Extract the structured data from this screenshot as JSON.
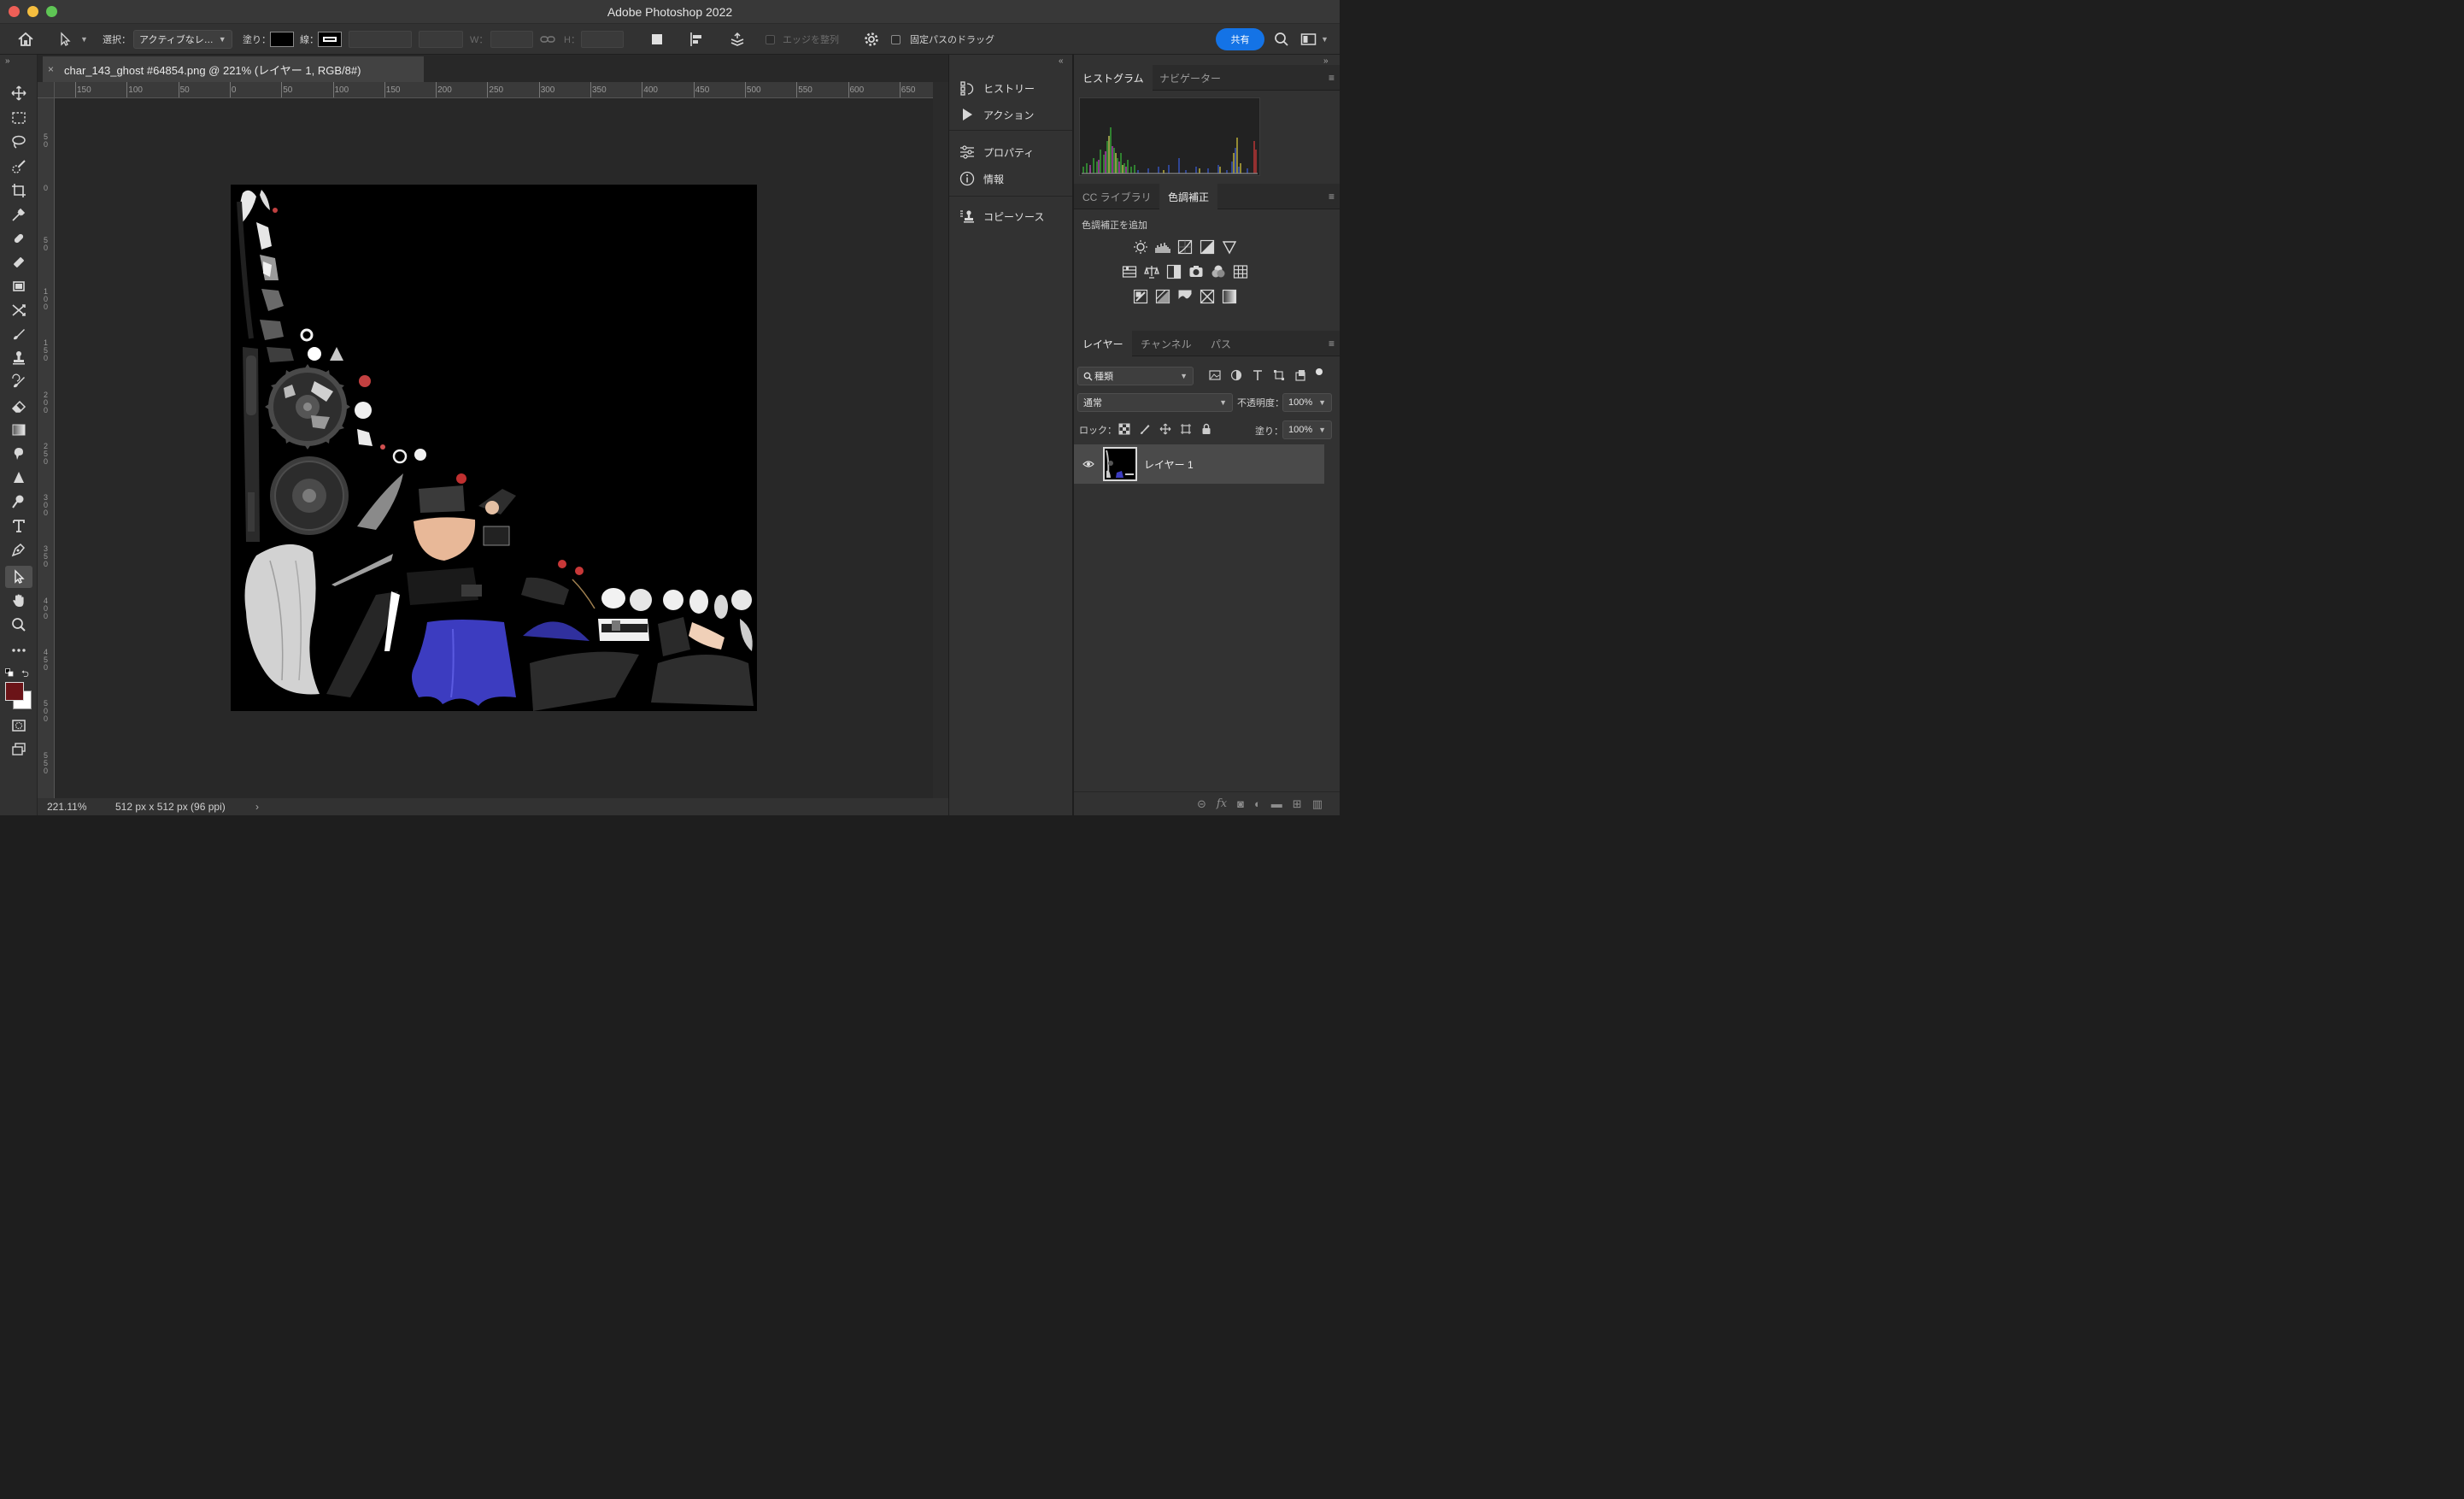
{
  "app": {
    "title": "Adobe Photoshop 2022"
  },
  "options_bar": {
    "select_label": "選択：",
    "select_value": "アクティブなレ…",
    "fill_label": "塗り：",
    "stroke_label": "線：",
    "w_label": "W：",
    "h_label": "H：",
    "align_edges_label": "エッジを整列",
    "fixed_path_drag_label": "固定パスのドラッグ",
    "share_label": "共有"
  },
  "document": {
    "tab_title": "char_143_ghost #64854.png @ 221% (レイヤー 1, RGB/8#)",
    "close_glyph": "×",
    "zoom": "221.11%",
    "doc_info": "512 px x 512 px (96 ppi)",
    "status_arrow": "›"
  },
  "ruler": {
    "top_labels": [
      "150",
      "100",
      "50",
      "0",
      "50",
      "100",
      "150",
      "200",
      "250",
      "300",
      "350",
      "400",
      "450",
      "500",
      "550",
      "600",
      "650"
    ],
    "left_labels": [
      "5\n0",
      "0",
      "5\n0",
      "1\n0\n0",
      "1\n5\n0",
      "2\n0\n0",
      "2\n5\n0",
      "3\n0\n0",
      "3\n5\n0",
      "4\n0\n0",
      "4\n5\n0",
      "5\n0\n0",
      "5\n5\n0"
    ]
  },
  "middle_panel": {
    "items": [
      {
        "label": "ヒストリー",
        "icon": "history-icon"
      },
      {
        "label": "アクション",
        "icon": "play-icon"
      },
      {
        "label": "プロパティ",
        "icon": "sliders-icon"
      },
      {
        "label": "情報",
        "icon": "info-icon"
      },
      {
        "label": "コピーソース",
        "icon": "clone-source-icon"
      }
    ]
  },
  "right_panel": {
    "top_tabs": [
      "ヒストグラム",
      "ナビゲーター"
    ],
    "mid_tabs": [
      "CC ライブラリ",
      "色調補正"
    ],
    "adjustments_label": "色調補正を追加",
    "layer_tabs": [
      "レイヤー",
      "チャンネル",
      "パス"
    ],
    "kind_filter": "種類",
    "blend_mode": "通常",
    "opacity_label": "不透明度：",
    "opacity_value": "100%",
    "lock_label": "ロック：",
    "fill_label": "塗り：",
    "fill_value": "100%",
    "layers": [
      {
        "name": "レイヤー 1",
        "visible": true
      }
    ]
  },
  "colors": {
    "foreground": "#6b1418",
    "background": "#ffffff",
    "accent": "#1473e6"
  }
}
